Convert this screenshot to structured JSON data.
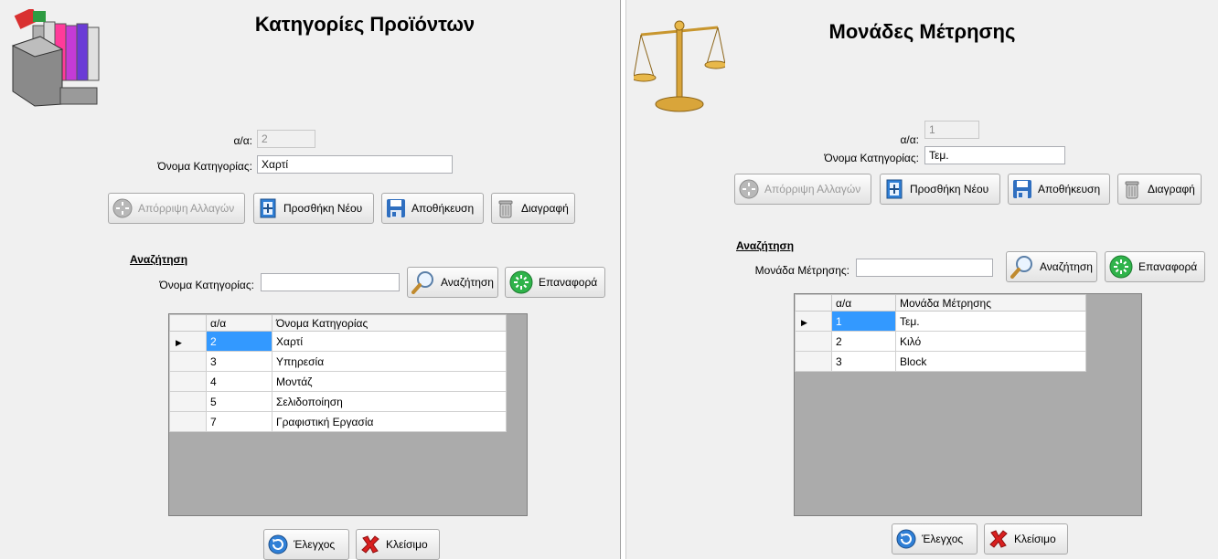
{
  "left": {
    "title": "Κατηγορίες Προϊόντων",
    "icon": "product-categories-icon",
    "aa_label": "α/α:",
    "aa_value": "2",
    "name_label": "Όνομα Κατηγορίας:",
    "name_value": "Χαρτί",
    "buttons": {
      "discard": "Απόρριψη Αλλαγών",
      "add_new": "Προσθήκη Νέου",
      "save": "Αποθήκευση",
      "delete": "Διαγραφή"
    },
    "search_section": "Αναζήτηση",
    "search_label": "Όνομα Κατηγορίας:",
    "search_value": "",
    "search_button": "Αναζήτηση",
    "reset_button": "Επαναφορά",
    "grid": {
      "columns": [
        "α/α",
        "Όνομα Κατηγορίας"
      ],
      "rows": [
        {
          "id": "2",
          "name": "Χαρτί"
        },
        {
          "id": "3",
          "name": "Υπηρεσία"
        },
        {
          "id": "4",
          "name": "Μοντάζ"
        },
        {
          "id": "5",
          "name": "Σελιδοποίηση"
        },
        {
          "id": "7",
          "name": "Γραφιστική Εργασία"
        }
      ]
    },
    "check_button": "Έλεγχος",
    "close_button": "Κλείσιμο"
  },
  "right": {
    "title": "Μονάδες Μέτρησης",
    "icon": "scales-icon",
    "aa_label": "α/α:",
    "aa_value": "1",
    "name_label": "Όνομα Κατηγορίας:",
    "name_value": "Τεμ.",
    "buttons": {
      "discard": "Απόρριψη Αλλαγών",
      "add_new": "Προσθήκη Νέου",
      "save": "Αποθήκευση",
      "delete": "Διαγραφή"
    },
    "search_section": "Αναζήτηση",
    "search_label": "Μονάδα Μέτρησης:",
    "search_value": "",
    "search_button": "Αναζήτηση",
    "reset_button": "Επαναφορά",
    "grid": {
      "columns": [
        "α/α",
        "Μονάδα Μέτρησης"
      ],
      "rows": [
        {
          "id": "1",
          "name": "Τεμ."
        },
        {
          "id": "2",
          "name": "Κιλό"
        },
        {
          "id": "3",
          "name": "Block"
        }
      ]
    },
    "check_button": "Έλεγχος",
    "close_button": "Κλείσιμο"
  },
  "colors": {
    "form_bg": "#f0f0f0",
    "selection": "#3399ff",
    "grid_bg": "#ababab"
  }
}
